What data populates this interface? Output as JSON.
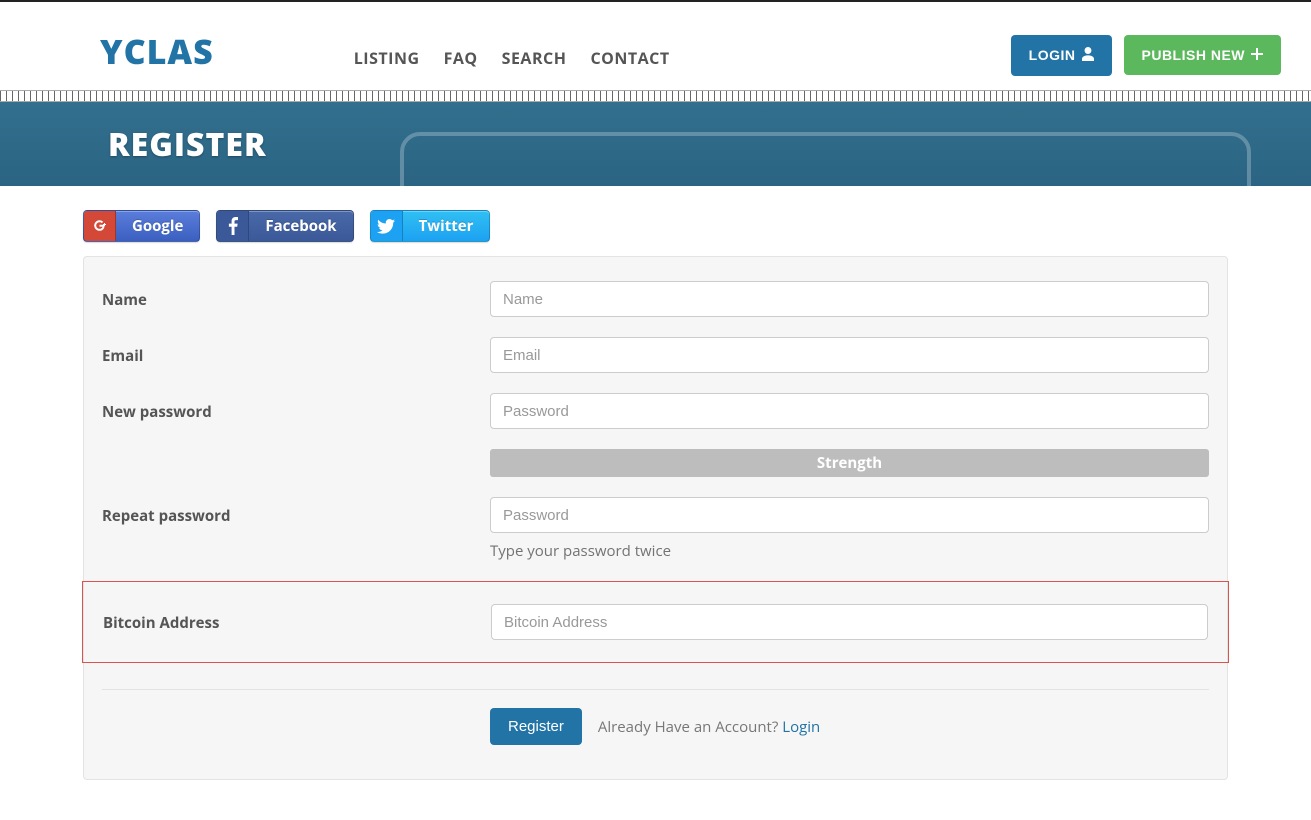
{
  "brand": "YCLAS",
  "nav": {
    "listing": "LISTING",
    "faq": "FAQ",
    "search": "SEARCH",
    "contact": "CONTACT"
  },
  "header": {
    "login": "LOGIN",
    "publish": "PUBLISH NEW"
  },
  "banner": {
    "title": "REGISTER"
  },
  "social": {
    "google": "Google",
    "facebook": "Facebook",
    "twitter": "Twitter"
  },
  "form": {
    "name": {
      "label": "Name",
      "placeholder": "Name"
    },
    "email": {
      "label": "Email",
      "placeholder": "Email"
    },
    "new_password": {
      "label": "New password",
      "placeholder": "Password",
      "strength": "Strength"
    },
    "repeat_password": {
      "label": "Repeat password",
      "placeholder": "Password",
      "help": "Type your password twice"
    },
    "bitcoin": {
      "label": "Bitcoin Address",
      "placeholder": "Bitcoin Address"
    },
    "submit": "Register",
    "already": "Already Have an Account?",
    "login_link": "Login"
  }
}
